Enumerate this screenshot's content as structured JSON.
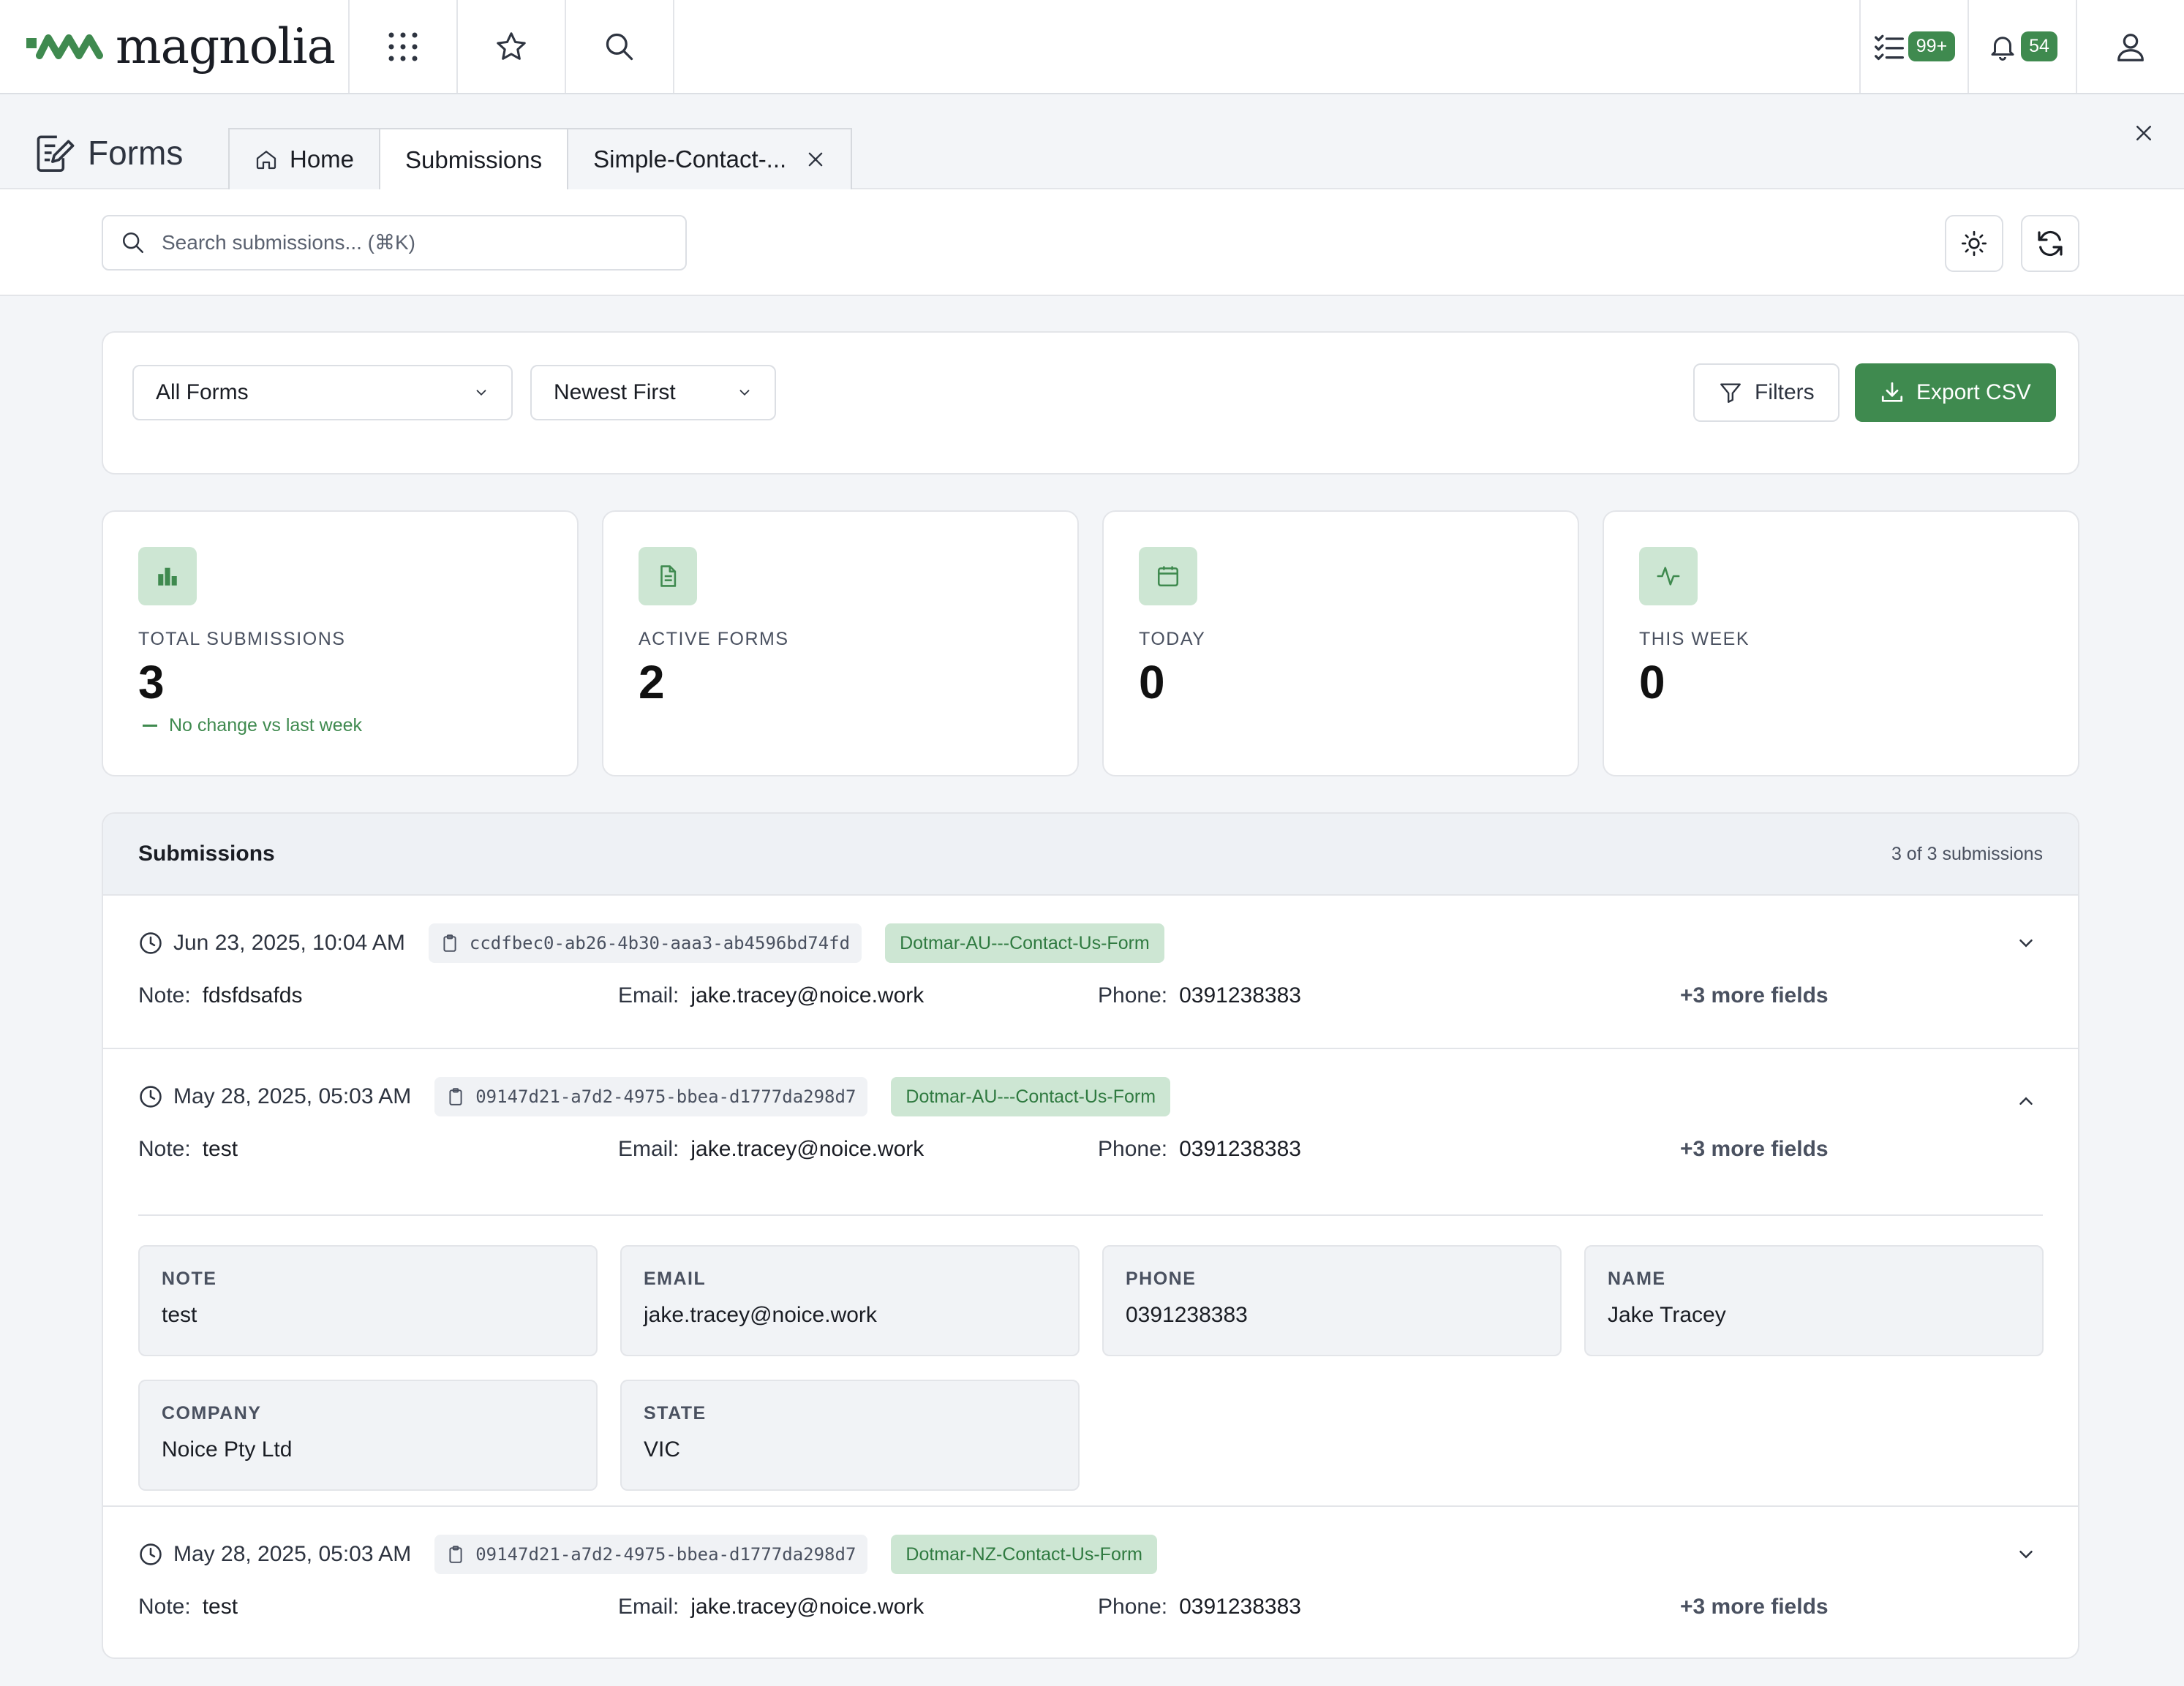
{
  "topbar": {
    "brand": "magnolia",
    "tasks_badge": "99+",
    "notifications_badge": "54"
  },
  "app": {
    "title": "Forms",
    "tabs": [
      {
        "label": "Home"
      },
      {
        "label": "Submissions"
      },
      {
        "label": "Simple-Contact-..."
      }
    ]
  },
  "search": {
    "placeholder": "Search submissions... (⌘K)"
  },
  "filters": {
    "form_select": "All Forms",
    "sort_select": "Newest First",
    "filters_label": "Filters",
    "export_label": "Export CSV"
  },
  "stats": [
    {
      "label": "TOTAL SUBMISSIONS",
      "value": "3",
      "trend": "No change vs last week",
      "icon": "chart-icon"
    },
    {
      "label": "ACTIVE FORMS",
      "value": "2",
      "icon": "document-icon"
    },
    {
      "label": "TODAY",
      "value": "0",
      "icon": "calendar-icon"
    },
    {
      "label": "THIS WEEK",
      "value": "0",
      "icon": "activity-icon"
    }
  ],
  "submissions": {
    "title": "Submissions",
    "count": "3 of 3 submissions",
    "rows": [
      {
        "date": "Jun 23, 2025, 10:04 AM",
        "id": "ccdfbec0-ab26-4b30-aaa3-ab4596bd74fd",
        "form": "Dotmar-AU---Contact-Us-Form",
        "note_label": "Note:",
        "note": "fdsfdsafds",
        "email_label": "Email:",
        "email": "jake.tracey@noice.work",
        "phone_label": "Phone:",
        "phone": "0391238383",
        "more": "+3 more fields",
        "expanded": false
      },
      {
        "date": "May 28, 2025, 05:03 AM",
        "id": "09147d21-a7d2-4975-bbea-d1777da298d7",
        "form": "Dotmar-AU---Contact-Us-Form",
        "note_label": "Note:",
        "note": "test",
        "email_label": "Email:",
        "email": "jake.tracey@noice.work",
        "phone_label": "Phone:",
        "phone": "0391238383",
        "more": "+3 more fields",
        "expanded": true,
        "details": [
          {
            "key": "NOTE",
            "value": "test"
          },
          {
            "key": "EMAIL",
            "value": "jake.tracey@noice.work"
          },
          {
            "key": "PHONE",
            "value": "0391238383"
          },
          {
            "key": "NAME",
            "value": "Jake Tracey"
          },
          {
            "key": "COMPANY",
            "value": "Noice Pty Ltd"
          },
          {
            "key": "STATE",
            "value": "VIC"
          }
        ]
      },
      {
        "date": "May 28, 2025, 05:03 AM",
        "id": "09147d21-a7d2-4975-bbea-d1777da298d7",
        "form": "Dotmar-NZ-Contact-Us-Form",
        "note_label": "Note:",
        "note": "test",
        "email_label": "Email:",
        "email": "jake.tracey@noice.work",
        "phone_label": "Phone:",
        "phone": "0391238383",
        "more": "+3 more fields",
        "expanded": false
      }
    ]
  },
  "colors": {
    "accent": "#3f8a4f",
    "accent_light": "#cde6d3"
  }
}
